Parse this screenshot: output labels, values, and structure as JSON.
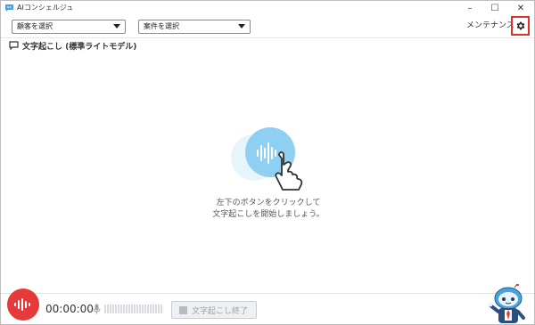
{
  "window": {
    "title": "AIコンシェルジュ",
    "controls": {
      "minimize": "–",
      "maximize": "☐",
      "close": "✕"
    }
  },
  "toolbar": {
    "customer_select": {
      "value": "顧客を選択"
    },
    "case_select": {
      "value": "案件を選択"
    },
    "maintenance_label": "メンテナンス"
  },
  "section": {
    "title": "文字起こし (標準ライトモデル)"
  },
  "main": {
    "hint_line1": "左下のボタンをクリックして",
    "hint_line2": "文字起こしを開始しましょう。"
  },
  "footer": {
    "timer": "00:00:00",
    "stop_label": "文字起こし終了",
    "audio_level": 0
  },
  "colors": {
    "accent_red": "#e63a3a",
    "illustration_blue": "#8fd0f2",
    "settings_highlight": "#e0302a"
  },
  "icons": {
    "app": "chat-bubble-icon",
    "settings": "gear-icon",
    "section": "speech-bubble-icon",
    "record": "waveform-icon",
    "mic": "microphone-icon",
    "mascot": "robot-mascot"
  }
}
